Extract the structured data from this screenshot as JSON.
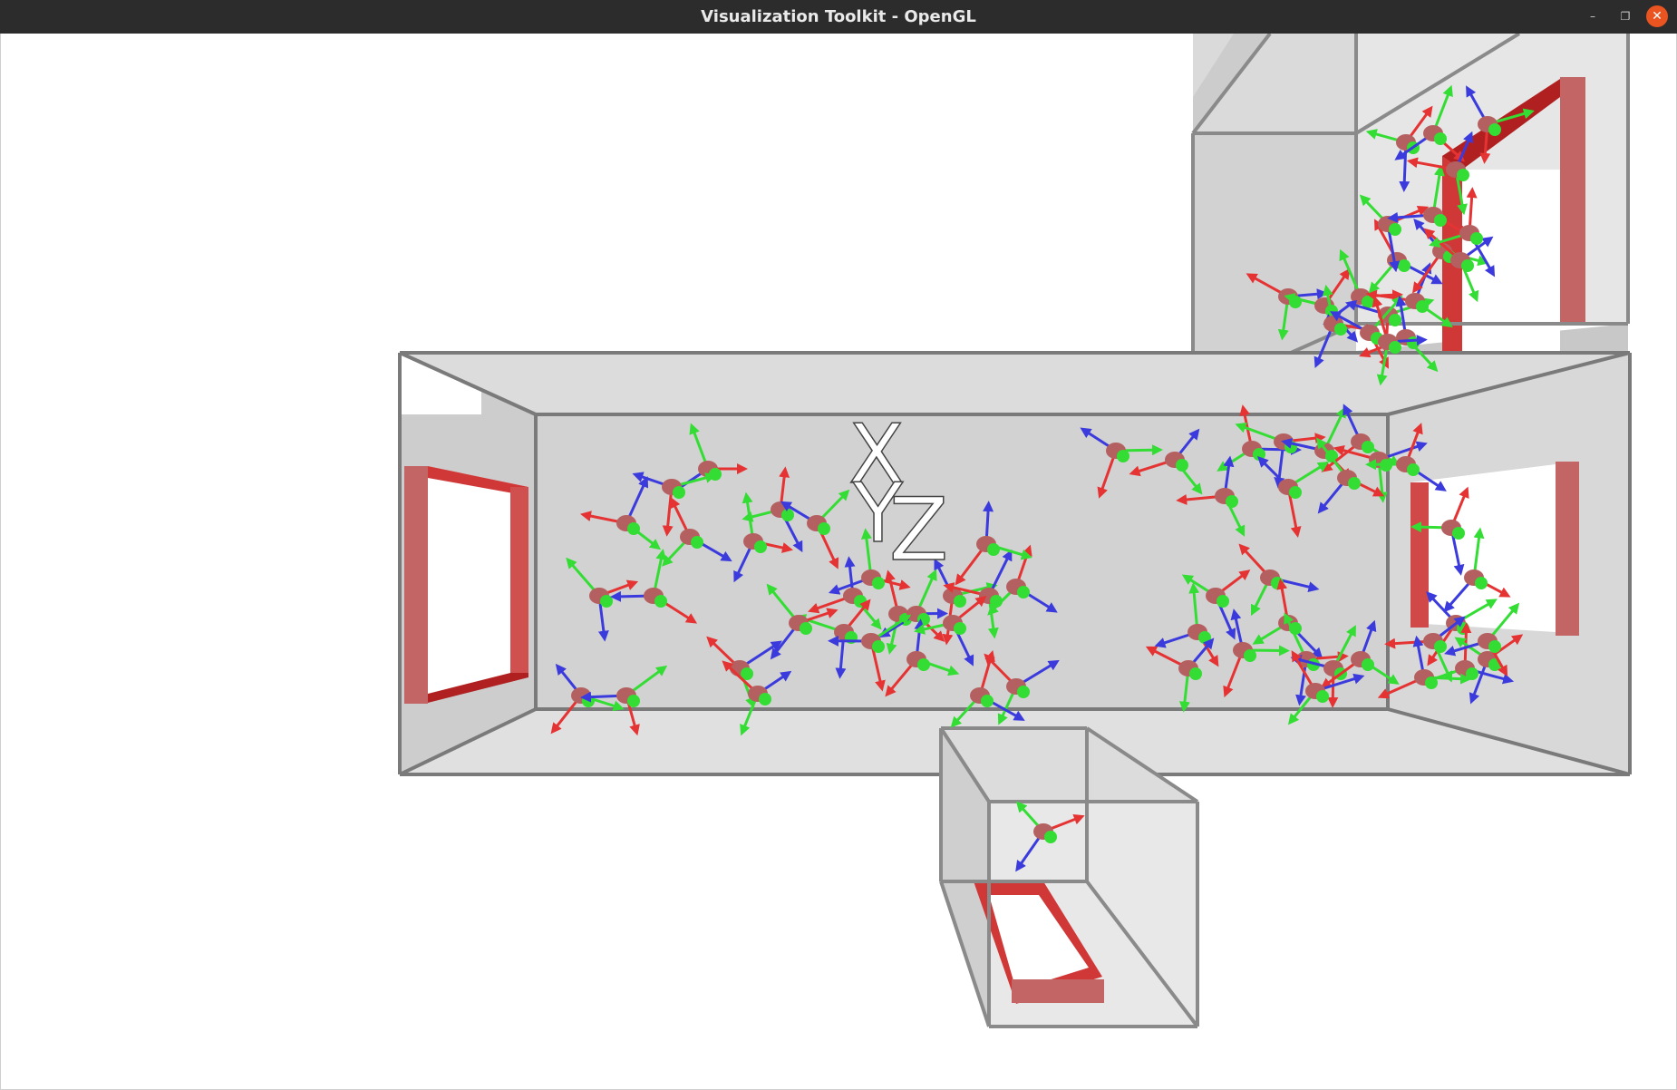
{
  "window": {
    "title": "Visualization Toolkit - OpenGL",
    "controls": {
      "minimize": "–",
      "restore": "❐",
      "close": "✕"
    }
  },
  "scene": {
    "axis_labels": {
      "x": "X",
      "y": "Y",
      "z": "Z"
    },
    "colors": {
      "background": "#ffffff",
      "wall": "#d0d0d0",
      "wall_light": "#e2e2e2",
      "edge": "#7a7a7a",
      "door": "#d03838",
      "door_dark": "#b02020",
      "agent": "#b56060",
      "arrow_x": "#e53333",
      "arrow_y": "#3b3bdd",
      "arrow_z": "#33dd33"
    }
  }
}
